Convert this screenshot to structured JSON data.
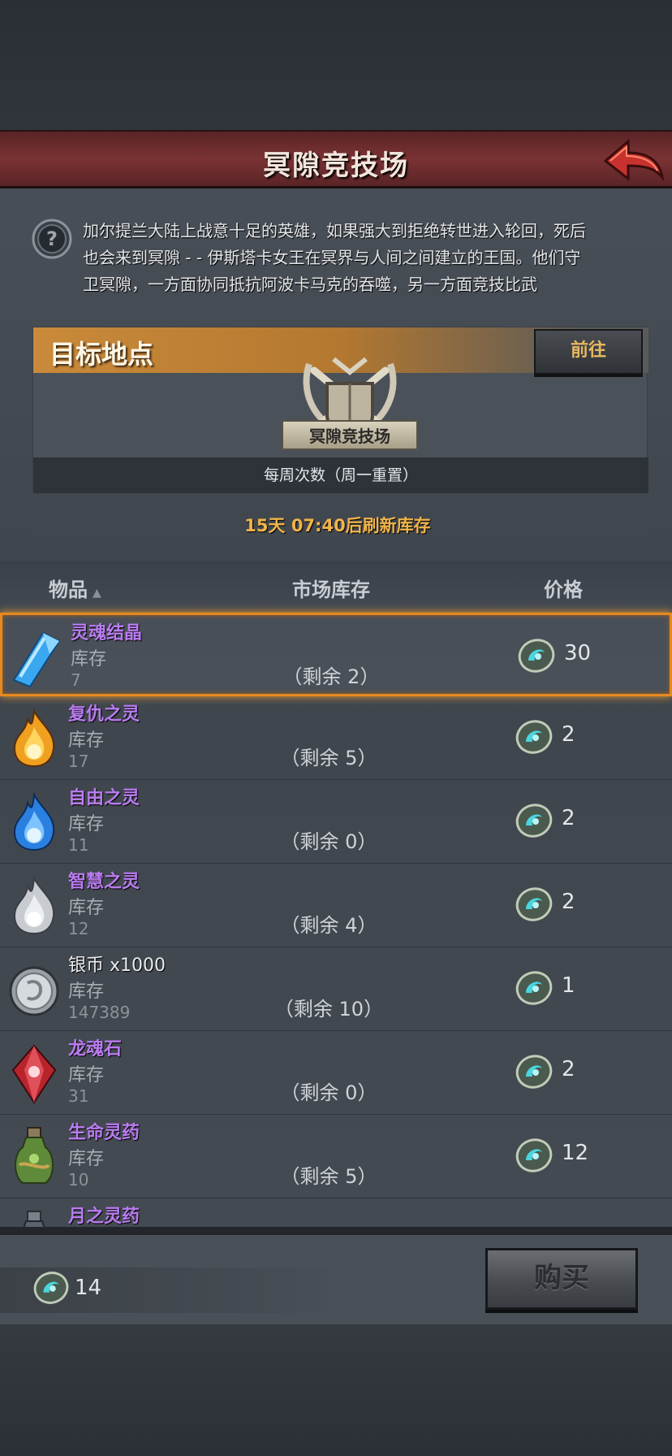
{
  "header": {
    "title": "冥隙竞技场"
  },
  "description": "加尔提兰大陆上战意十足的英雄，如果强大到拒绝转世进入轮回，死后也会来到冥隙 - - 伊斯塔卡女王在冥界与人间之间建立的王国。他们守卫冥隙，一方面协同抵抗阿波卡马克的吞噬，另一方面竞技比武",
  "target": {
    "label": "目标地点",
    "go_label": "前往",
    "emblem_label": "冥隙竞技场",
    "weekly_text": "每周次数（周一重置）"
  },
  "refresh_text": "15天 07:40后刷新库存",
  "table": {
    "col_item": "物品",
    "col_stock": "市场库存",
    "col_price": "价格",
    "rows": [
      {
        "name": "灵魂结晶",
        "stock_label": "库存",
        "stock": "7",
        "remain": "（剩余 2）",
        "price": "30",
        "icon": "soul-crystal-icon"
      },
      {
        "name": "复仇之灵",
        "stock_label": "库存",
        "stock": "17",
        "remain": "（剩余 5）",
        "price": "2",
        "icon": "vengeance-spirit-icon"
      },
      {
        "name": "自由之灵",
        "stock_label": "库存",
        "stock": "11",
        "remain": "（剩余 0）",
        "price": "2",
        "icon": "freedom-spirit-icon"
      },
      {
        "name": "智慧之灵",
        "stock_label": "库存",
        "stock": "12",
        "remain": "（剩余 4）",
        "price": "2",
        "icon": "wisdom-spirit-icon"
      },
      {
        "name": "银币 x1000",
        "stock_label": "库存",
        "stock": "147389",
        "remain": "（剩余 10）",
        "price": "1",
        "icon": "silver-coin-icon"
      },
      {
        "name": "龙魂石",
        "stock_label": "库存",
        "stock": "31",
        "remain": "（剩余 0）",
        "price": "2",
        "icon": "dragon-soul-stone-icon"
      },
      {
        "name": "生命灵药",
        "stock_label": "库存",
        "stock": "10",
        "remain": "（剩余 5）",
        "price": "12",
        "icon": "life-elixir-icon"
      },
      {
        "name": "月之灵药",
        "icon": "moon-elixir-icon"
      }
    ]
  },
  "footer": {
    "currency": "14",
    "buy_label": "购买"
  },
  "colors": {
    "accent_orange": "#e68a20",
    "item_name_purple": "#b97cf0",
    "refresh_gold": "#f0b44a"
  }
}
